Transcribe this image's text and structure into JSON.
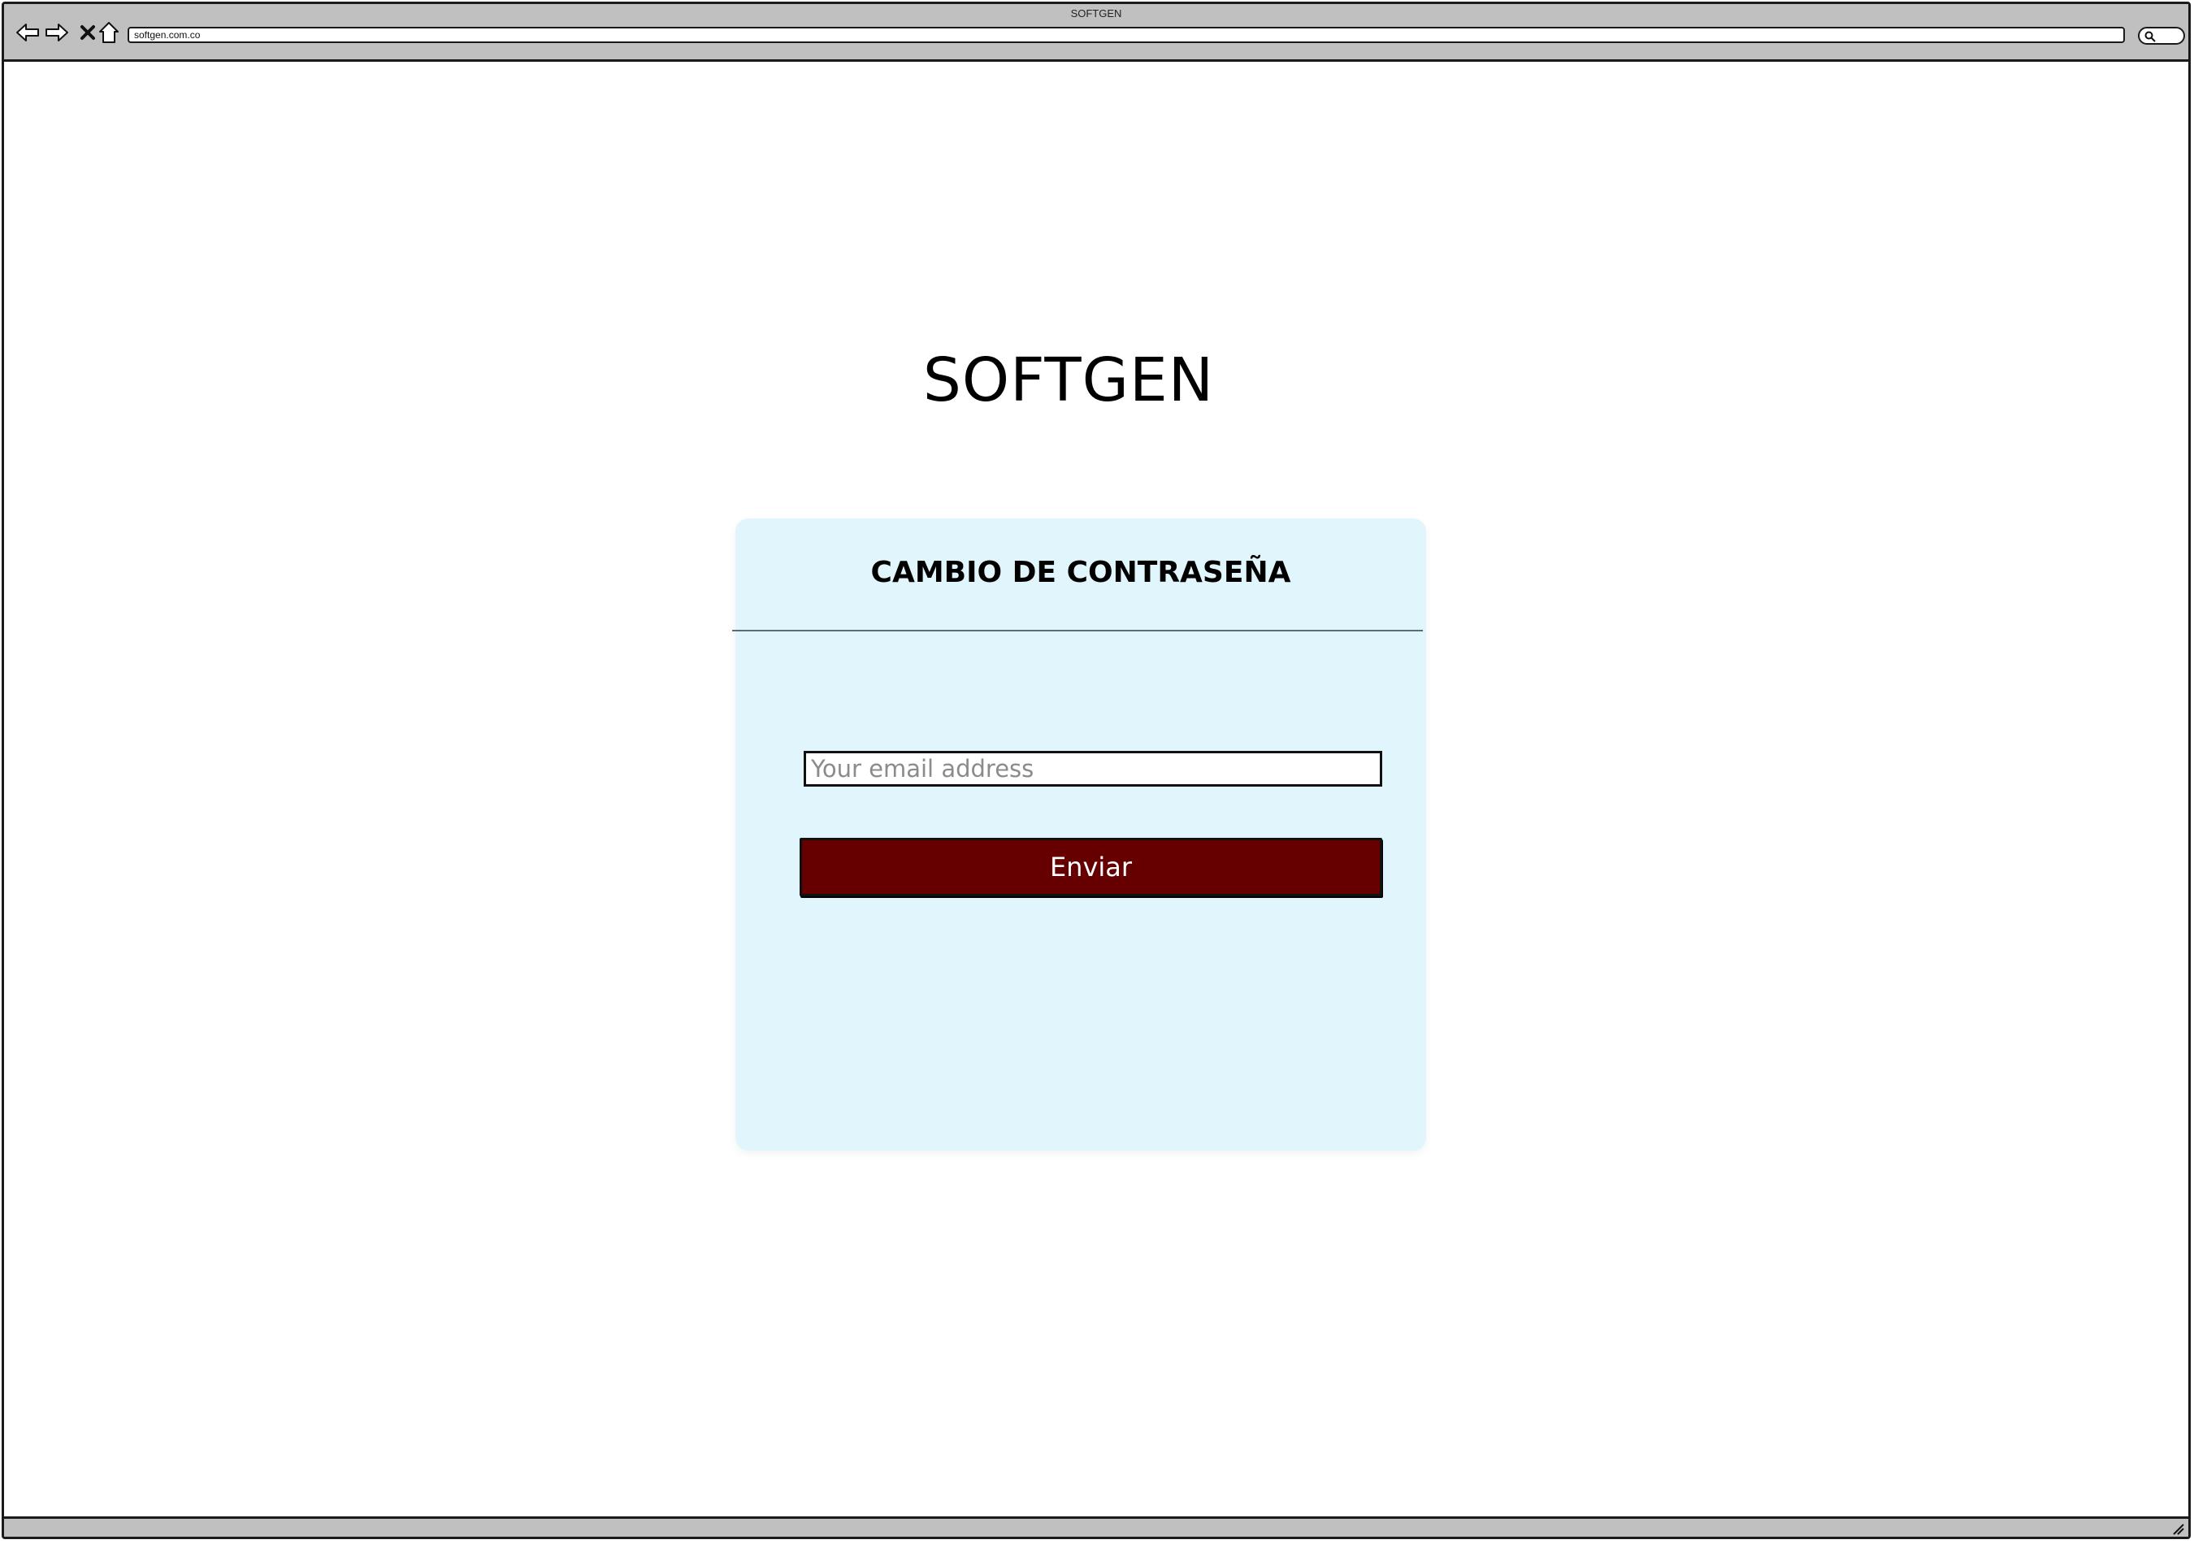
{
  "browser": {
    "window_title": "SOFTGEN",
    "url": "softgen.com.co",
    "icons": {
      "back": "arrow-left-icon",
      "forward": "arrow-right-icon",
      "stop": "close-icon",
      "home": "home-icon",
      "search": "search-icon",
      "resize": "resize-grip-icon"
    }
  },
  "page": {
    "logo_text": "SOFTGEN"
  },
  "card": {
    "title": "CAMBIO DE CONTRASEÑA",
    "email_placeholder": "Your email address",
    "email_value": "",
    "submit_label": "Enviar"
  },
  "colors": {
    "card_background": "#e1f5fc",
    "button_background": "#660000",
    "chrome_background": "#c0c0c0"
  }
}
